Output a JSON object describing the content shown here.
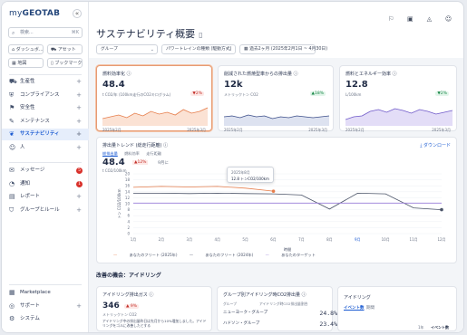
{
  "brand": {
    "logo_prefix": "my",
    "logo_name": "GEOTAB"
  },
  "sidebar": {
    "search_placeholder": "検索...",
    "search_kbd": "⌘K",
    "quick": [
      "ダッシュボ...",
      "アセット",
      "地図",
      "ブックマーク"
    ],
    "items": [
      {
        "icon": "truck-icon",
        "glyph": "⛟",
        "label": "生産性"
      },
      {
        "icon": "shield-icon",
        "glyph": "⛨",
        "label": "コンプライアンス"
      },
      {
        "icon": "safety-icon",
        "glyph": "⚑",
        "label": "安全性"
      },
      {
        "icon": "wrench-icon",
        "glyph": "✎",
        "label": "メンテナンス"
      },
      {
        "icon": "leaf-icon",
        "glyph": "❦",
        "label": "サステナビリティ"
      },
      {
        "icon": "people-icon",
        "glyph": "☺",
        "label": "人"
      }
    ],
    "items2": [
      {
        "icon": "message-icon",
        "glyph": "✉",
        "label": "メッセージ",
        "badge": "5"
      },
      {
        "icon": "alert-icon",
        "glyph": "◔",
        "label": "通知",
        "badge": "1"
      },
      {
        "icon": "report-icon",
        "glyph": "▤",
        "label": "レポート"
      },
      {
        "icon": "rule-icon",
        "glyph": "⛉",
        "label": "グループとルール"
      }
    ],
    "items3": [
      {
        "icon": "marketplace-icon",
        "glyph": "▦",
        "label": "Marketplace"
      },
      {
        "icon": "support-icon",
        "glyph": "◎",
        "label": "サポート"
      },
      {
        "icon": "system-icon",
        "glyph": "⚙",
        "label": "システム"
      }
    ]
  },
  "header": {
    "title": "サステナビリティ概要",
    "filters": [
      "グループ",
      "パワートレインの種類 (駆動方式)",
      "過去2ヶ月 (2025年2月1日 ~ 4月30日)"
    ]
  },
  "kpis": [
    {
      "title": "燃料効率化 ⓘ",
      "value": "48.4",
      "sub": "t CO2/年 (100km走行のCO2キログラム)",
      "change": "▼2%",
      "dir": "up",
      "d1": "2025年2月",
      "d2": "2025年3月",
      "color": "#e67e4c",
      "fill": "#fbe2d4"
    },
    {
      "title": "削減された燃焼型車からの排出量 ⓘ",
      "value": "12k",
      "sub": "メトリックトン CO2",
      "change": "▲18%",
      "dir": "down",
      "d1": "2025年2月",
      "d2": "2025年3月",
      "color": "#3d4f8a",
      "fill": "#dde2f0"
    },
    {
      "title": "燃料とエネルギー効率 ⓘ",
      "value": "12.8",
      "sub": "L/100km",
      "change": "▼2%",
      "dir": "down",
      "d1": "2025年2月",
      "d2": "2025年3月",
      "color": "#6f59c9",
      "fill": "#e3ddf7"
    }
  ],
  "trend": {
    "title": "排出量トレンド (総走行距離) ⓘ",
    "download": "⤓ ダウンロード",
    "tabs": [
      "総排出量",
      "燃料効率",
      "走行距離"
    ],
    "value": "48.4",
    "change": "▲12%",
    "period": "9月に",
    "unit": "t CO2/100km",
    "tooltip_date": "2025年8月",
    "tooltip_val": "12.8 トンCO2/100km",
    "xaxis_label": "時間",
    "yaxis_label": "トン CO2/100km"
  },
  "chart_data": {
    "type": "line",
    "x": [
      "1月",
      "2月",
      "3月",
      "4月",
      "5月",
      "6月",
      "7月",
      "8月",
      "9月",
      "10月",
      "11月",
      "12月"
    ],
    "ylim": [
      0,
      20
    ],
    "yticks": [
      0,
      2,
      4,
      6,
      8,
      10,
      12,
      14,
      16,
      18,
      20
    ],
    "series": [
      {
        "name": "あなたのフリート (2025年)",
        "color": "#e67e4c",
        "values": [
          15.5,
          15.8,
          15.6,
          15.8,
          15.2,
          14.2
        ]
      },
      {
        "name": "あなたのフリート (2024年)",
        "color": "#4b5468",
        "values": [
          13.5,
          13.5,
          13.4,
          13.5,
          13.4,
          13.3,
          12.9,
          8.2,
          13.5,
          13.3,
          8.6,
          8.0
        ]
      },
      {
        "name": "あなたのターゲット",
        "color": "#9b7fd9",
        "values": [
          10.2,
          10.2,
          10.2,
          10.2,
          10.2,
          10.2,
          10.2,
          10.2,
          10.2,
          10.2,
          10.2,
          10.2
        ]
      }
    ],
    "legend": "bottom-left",
    "grid": true
  },
  "section": {
    "title": "改善の機会：アイドリング",
    "card1": {
      "title": "アイドリング排出ガス ⓘ",
      "value": "346",
      "change": "▲ 9%",
      "sub": "メトリックトン CO2",
      "desc": "アイドリング中の排出量昨日は先月から10%増加しました。アイドリングをゴルに改善したとする"
    },
    "card2": {
      "title": "グループ別アイドリング時CO2排出量 ⓘ",
      "h1": "グループ",
      "h2": "アイドリング時CO2排出量割合",
      "rows": [
        {
          "label": "ニューヨーク・グループ",
          "value": "24.8%"
        },
        {
          "label": "ハドソン・グループ",
          "value": "23.4%"
        }
      ]
    },
    "card3": {
      "title": "アイドリング",
      "tab1": "イベント数",
      "tab2": "期間",
      "foot1": "1年",
      "foot2": "イベント数"
    }
  }
}
